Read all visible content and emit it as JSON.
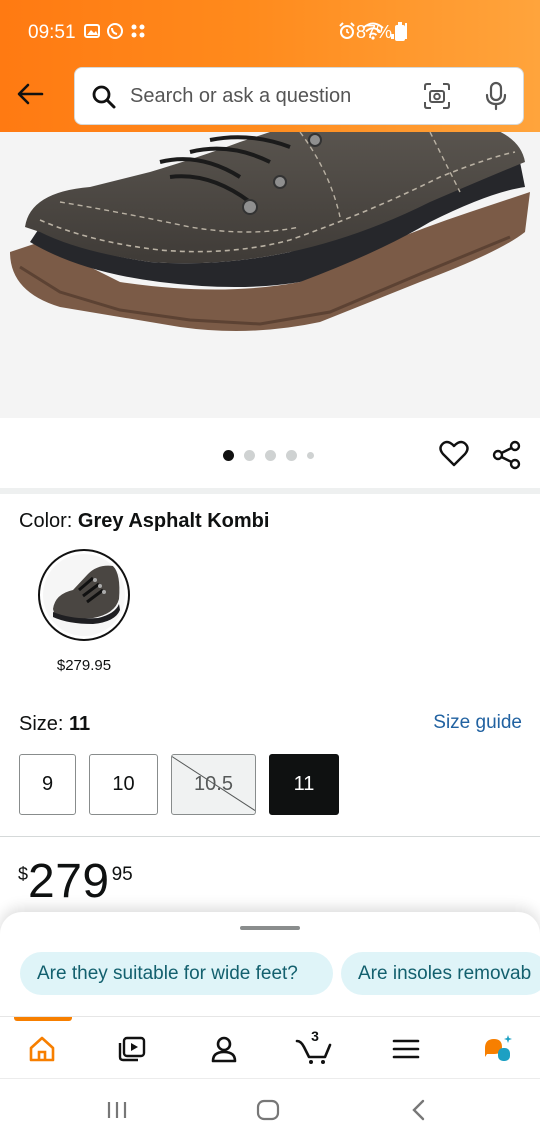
{
  "status_bar": {
    "time": "09:51",
    "battery": "87%"
  },
  "search": {
    "placeholder": "Search or ask a question"
  },
  "gallery": {
    "image_count": 5,
    "active_index": 0
  },
  "color": {
    "label": "Color:",
    "value": "Grey Asphalt Kombi",
    "swatch_price": "$279.95"
  },
  "size": {
    "label": "Size:",
    "value": "11",
    "guide_label": "Size guide",
    "options": [
      {
        "label": "9",
        "state": "available"
      },
      {
        "label": "10",
        "state": "available"
      },
      {
        "label": "10.5",
        "state": "unavailable"
      },
      {
        "label": "11",
        "state": "selected"
      }
    ]
  },
  "price": {
    "currency": "$",
    "whole": "279",
    "fraction": "95"
  },
  "questions": {
    "chips": [
      "Are they suitable for wide feet?",
      "Are insoles removab"
    ]
  },
  "nav": {
    "cart_count": "3",
    "active": "home"
  },
  "colors": {
    "header_start": "#ff7a12",
    "header_end": "#ffa43c",
    "link": "#2162a1",
    "chip_bg": "#dff4f8",
    "chip_text": "#13606e",
    "active_nav": "#f77f00"
  }
}
